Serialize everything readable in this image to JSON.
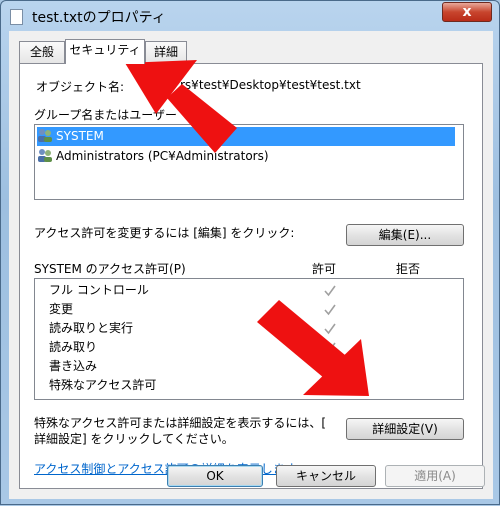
{
  "window": {
    "title": "test.txtのプロパティ",
    "close_glyph": "x"
  },
  "tabs": [
    {
      "label": "全般"
    },
    {
      "label": "セキュリティ"
    },
    {
      "label": "詳細"
    }
  ],
  "security": {
    "object_name_label": "オブジェクト名:",
    "object_name_value": "rs¥test¥Desktop¥test¥test.txt",
    "groups_label": "グループ名またはユーザー",
    "groups": [
      {
        "name": "SYSTEM",
        "selected": true
      },
      {
        "name": "Administrators (PC¥Administrators)",
        "selected": false
      }
    ],
    "change_hint": "アクセス許可を変更するには [編集] をクリック:",
    "edit_button": "編集(E)...",
    "perm_header": "SYSTEM のアクセス許可(P)",
    "allow_header": "許可",
    "deny_header": "拒否",
    "permissions": [
      {
        "name": "フル コントロール",
        "allow": true
      },
      {
        "name": "変更",
        "allow": true
      },
      {
        "name": "読み取りと実行",
        "allow": true
      },
      {
        "name": "読み取り",
        "allow": true
      },
      {
        "name": "書き込み",
        "allow": true
      },
      {
        "name": "特殊なアクセス許可",
        "allow": false
      }
    ],
    "advanced_hint_line1": "特殊なアクセス許可または詳細設定を表示するには、[",
    "advanced_hint_line2": "詳細設定] をクリックしてください。",
    "advanced_button": "詳細設定(V)",
    "help_link": "アクセス制御とアクセス許可の詳細を表示します。"
  },
  "footer": {
    "ok": "OK",
    "cancel": "キャンセル",
    "apply": "適用(A)"
  },
  "colors": {
    "selection": "#3399ff",
    "arrow_red": "#ee1111",
    "link": "#0066cc"
  }
}
